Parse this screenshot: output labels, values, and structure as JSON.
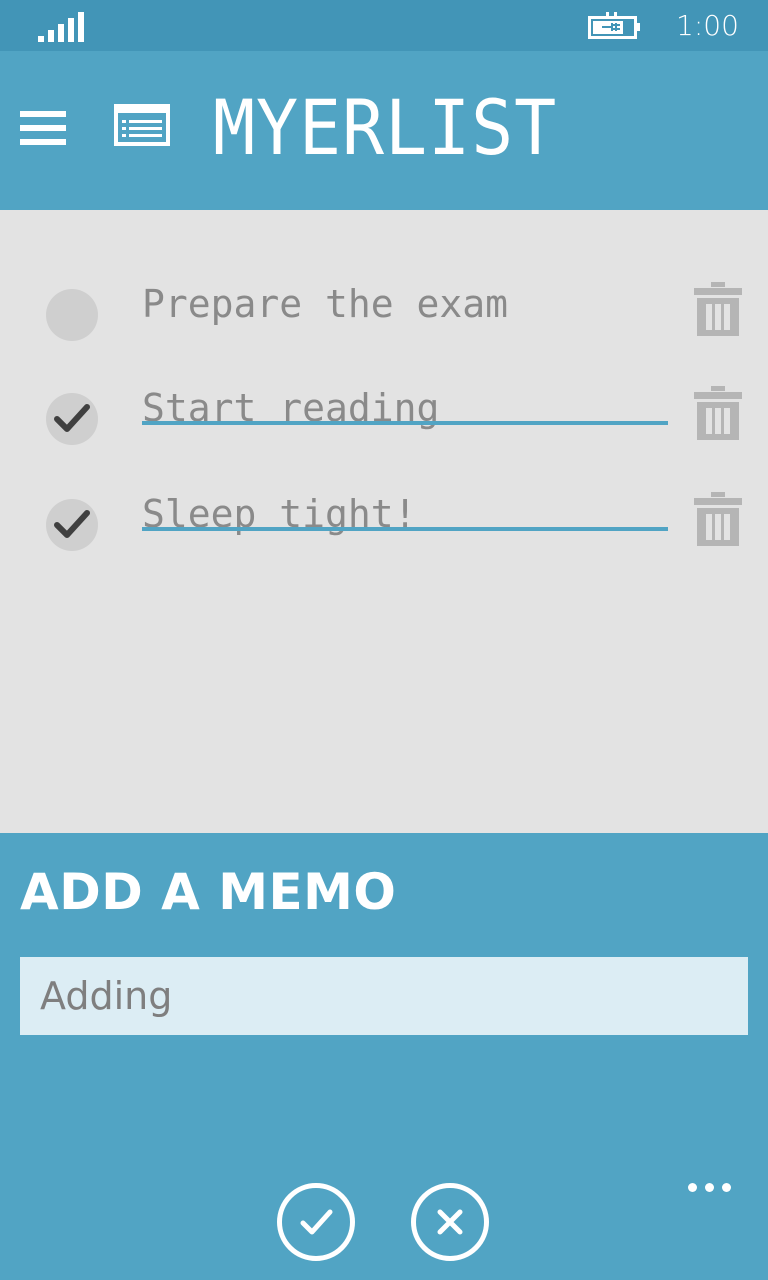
{
  "status_bar": {
    "time": "1:00",
    "signal_icon": "signal-strength-icon",
    "battery_icon": "battery-charging-icon"
  },
  "header": {
    "title": "MYERLIST",
    "menu_icon": "hamburger-menu-icon",
    "list_icon": "list-icon"
  },
  "todos": [
    {
      "text": "Prepare the exam",
      "done": false
    },
    {
      "text": "Start reading",
      "done": true
    },
    {
      "text": "Sleep tight!",
      "done": true
    }
  ],
  "memo_panel": {
    "title": "ADD A MEMO",
    "input_value": "Adding",
    "confirm_icon": "check-icon",
    "cancel_icon": "close-icon",
    "more_icon": "more-dots-icon"
  },
  "colors": {
    "status_bar": "#4295b7",
    "accent": "#51a4c4",
    "list_background": "#e3e3e3",
    "input_background": "#dcedf4"
  }
}
